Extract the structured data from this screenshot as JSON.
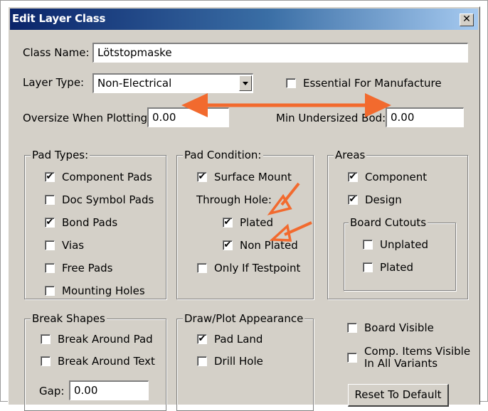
{
  "window": {
    "title": "Edit Layer Class",
    "close_glyph": "✕"
  },
  "class_name": {
    "label": "Class Name:",
    "value": "Lötstopmaske"
  },
  "layer_type": {
    "label": "Layer Type:",
    "value": "Non-Electrical"
  },
  "essential": {
    "label": "Essential For Manufacture",
    "checked": false
  },
  "oversize": {
    "label": "Oversize When Plotting:",
    "value": "0.00"
  },
  "min_undersized": {
    "label": "Min Undersized Bod:",
    "value": "0.00"
  },
  "pad_types": {
    "legend": "Pad Types:",
    "items": [
      {
        "label": "Component Pads",
        "checked": true
      },
      {
        "label": "Doc Symbol Pads",
        "checked": false
      },
      {
        "label": "Bond Pads",
        "checked": true
      },
      {
        "label": "Vias",
        "checked": false
      },
      {
        "label": "Free Pads",
        "checked": false
      },
      {
        "label": "Mounting Holes",
        "checked": false
      }
    ]
  },
  "pad_condition": {
    "legend": "Pad Condition:",
    "surface_mount": {
      "label": "Surface Mount",
      "checked": true
    },
    "through_hole_label": "Through Hole:",
    "plated": {
      "label": "Plated",
      "checked": true
    },
    "non_plated": {
      "label": "Non Plated",
      "checked": true
    },
    "only_if_testpoint": {
      "label": "Only If Testpoint",
      "checked": false
    }
  },
  "areas": {
    "legend": "Areas",
    "component": {
      "label": "Component",
      "checked": true
    },
    "design": {
      "label": "Design",
      "checked": true
    },
    "board_cutouts": {
      "legend": "Board Cutouts",
      "unplated": {
        "label": "Unplated",
        "checked": false
      },
      "plated": {
        "label": "Plated",
        "checked": false
      }
    }
  },
  "break_shapes": {
    "legend": "Break Shapes",
    "around_pad": {
      "label": "Break Around Pad",
      "checked": false
    },
    "around_text": {
      "label": "Break Around Text",
      "checked": false
    },
    "gap_label": "Gap:",
    "gap_value": "0.00"
  },
  "draw_plot": {
    "legend": "Draw/Plot Appearance",
    "pad_land": {
      "label": "Pad Land",
      "checked": true
    },
    "drill_hole": {
      "label": "Drill Hole",
      "checked": false
    }
  },
  "board_visible": {
    "label": "Board Visible",
    "checked": false
  },
  "comp_items_visible": {
    "label_line1": "Comp. Items Visible",
    "label_line2": "In All Variants",
    "checked": false
  },
  "reset_button": {
    "label": "Reset To Default"
  },
  "annotation_color": "#f26a2e"
}
